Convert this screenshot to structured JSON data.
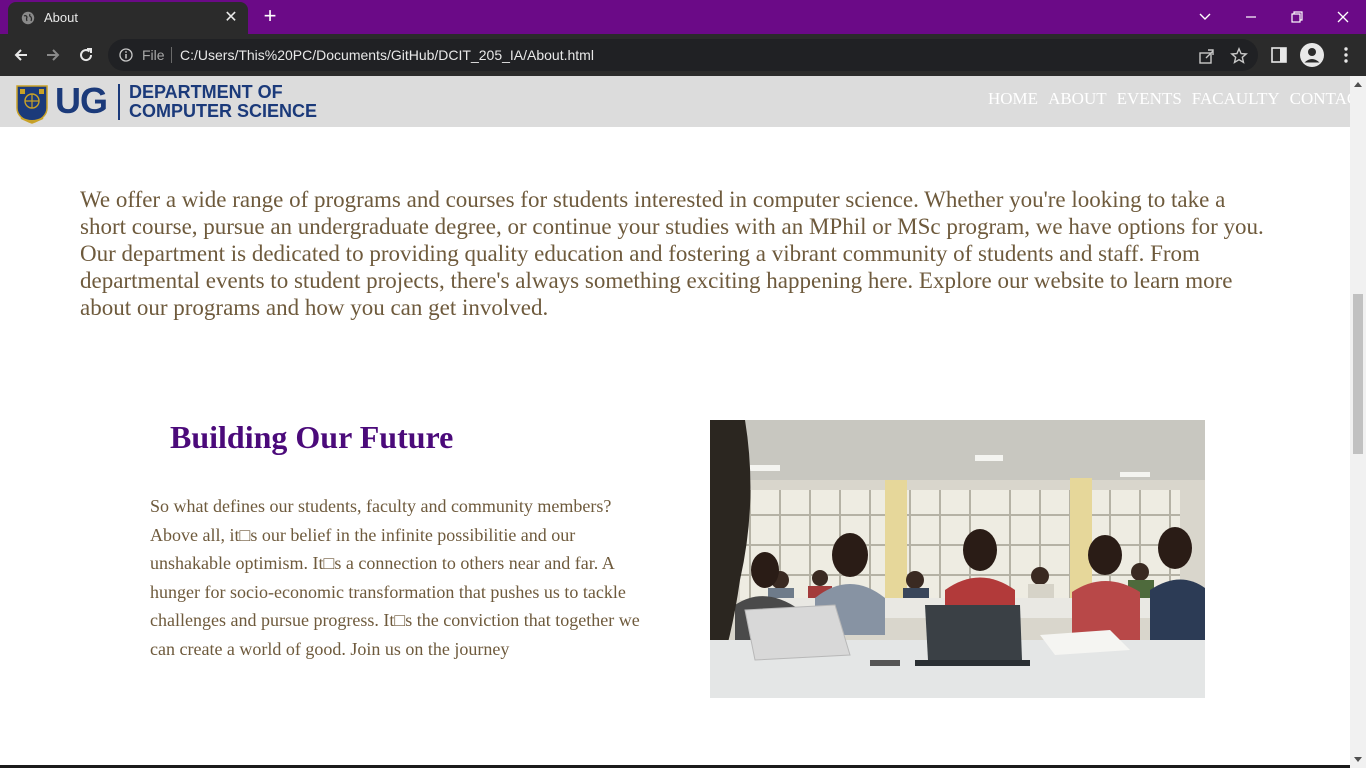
{
  "browser": {
    "tab_title": "About",
    "file_label": "File",
    "url": "C:/Users/This%20PC/Documents/GitHub/DCIT_205_IA/About.html",
    "titlebar_color": "#6b0a87"
  },
  "site": {
    "logo_ug": "UG",
    "logo_dept_line1": "DEPARTMENT OF",
    "logo_dept_line2": "COMPUTER SCIENCE",
    "nav": [
      "HOME",
      "ABOUT",
      "EVENTS",
      "FACAULTY",
      "CONTACT"
    ],
    "brand_color": "#1b3a7a",
    "accent_color": "#4b0a7a",
    "text_color": "#6e5a3c"
  },
  "intro": {
    "text": "We offer a wide range of programs and courses for students interested in computer science. Whether you're looking to take a short course, pursue an undergraduate degree, or continue your studies with an MPhil or MSc program, we have options for you. Our department is dedicated to providing quality education and fostering a vibrant community of students and staff. From departmental events to student projects, there's always something exciting happening here. Explore our website to learn more about our programs and how you can get involved."
  },
  "feature": {
    "title": "Building Our Future",
    "body": "So what defines our students, faculty and community members? Above all, it□s our belief in the infinite possibilitie and our unshakable optimism. It□s a connection to others near and far. A hunger for socio-economic transformation that pushes us to tackle challenges and pursue progress. It□s the conviction that together we can create a world of good. Join us on the journey"
  }
}
